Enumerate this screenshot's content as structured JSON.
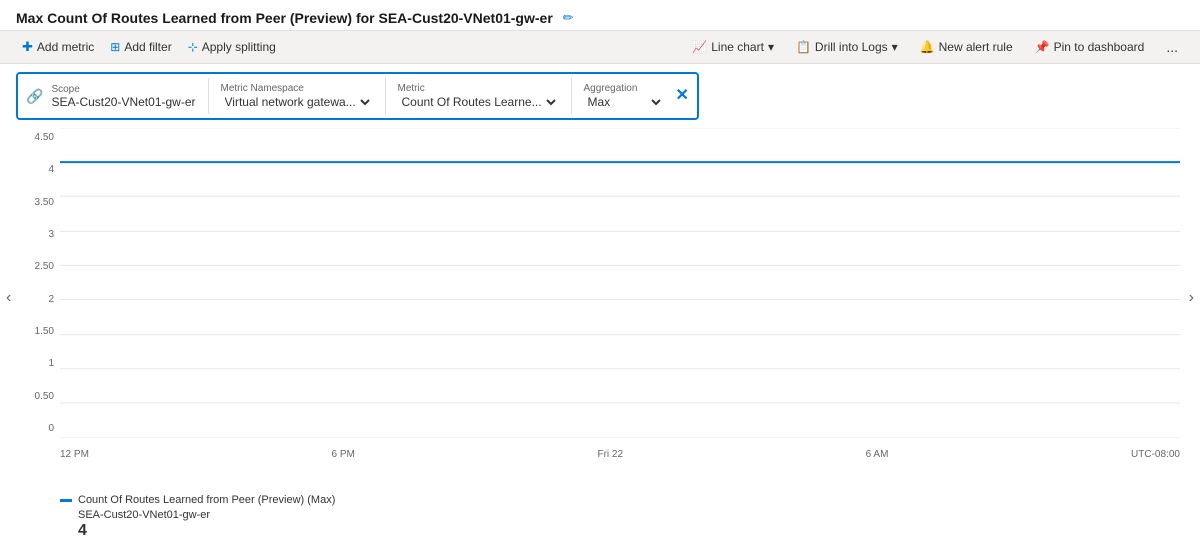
{
  "header": {
    "title": "Max Count Of Routes Learned from Peer (Preview) for SEA-Cust20-VNet01-gw-er",
    "edit_tooltip": "Edit"
  },
  "toolbar": {
    "left": [
      {
        "id": "add-metric",
        "label": "Add metric",
        "icon": "plus"
      },
      {
        "id": "add-filter",
        "label": "Add filter",
        "icon": "filter"
      },
      {
        "id": "apply-splitting",
        "label": "Apply splitting",
        "icon": "split"
      }
    ],
    "right": [
      {
        "id": "line-chart",
        "label": "Line chart",
        "icon": "chart"
      },
      {
        "id": "drill-into-logs",
        "label": "Drill into Logs",
        "icon": "logs"
      },
      {
        "id": "new-alert-rule",
        "label": "New alert rule",
        "icon": "alert"
      },
      {
        "id": "pin-to-dashboard",
        "label": "Pin to dashboard",
        "icon": "pin"
      },
      {
        "id": "more-options",
        "label": "...",
        "icon": "ellipsis"
      }
    ]
  },
  "filter": {
    "scope_label": "Scope",
    "scope_value": "SEA-Cust20-VNet01-gw-er",
    "namespace_label": "Metric Namespace",
    "namespace_value": "Virtual network gatewa...",
    "metric_label": "Metric",
    "metric_value": "Count Of Routes Learne...",
    "aggregation_label": "Aggregation",
    "aggregation_value": "Max"
  },
  "chart": {
    "y_labels": [
      "4.50",
      "4",
      "3.50",
      "3",
      "2.50",
      "2",
      "1.50",
      "1",
      "0.50",
      "0"
    ],
    "x_labels": [
      "12 PM",
      "6 PM",
      "Fri 22",
      "6 AM",
      "UTC-08:00"
    ],
    "data_value": 4,
    "timezone": "UTC-08:00"
  },
  "legend": {
    "label": "Count Of Routes Learned from Peer (Preview) (Max)",
    "sublabel": "SEA-Cust20-VNet01-gw-er",
    "value": "4"
  },
  "nav": {
    "left": "<",
    "right": ">"
  }
}
